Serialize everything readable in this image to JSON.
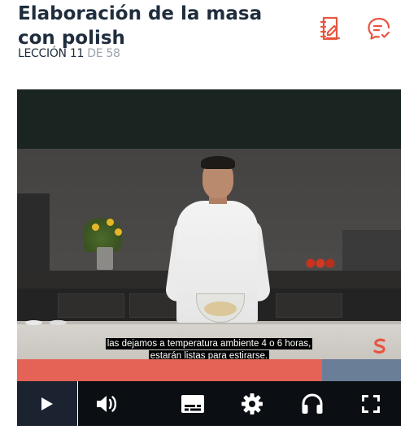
{
  "header": {
    "title": "Elaboración de la masa con polish",
    "lesson_label": "LECCIÓN",
    "lesson_current": "11",
    "lesson_of": "DE",
    "lesson_total": "58",
    "notes_icon": "notebook-edit-icon",
    "comments_icon": "chat-bubble-icon",
    "accent_color": "#e8553f"
  },
  "player": {
    "subtitle_line1": "las dejamos a temperatura ambiente 4 o 6 horas,",
    "subtitle_line2": "estarán listas para estirarse.",
    "progress_fraction": 0.795,
    "progress_color": "#e46356",
    "track_color": "#6a7e98",
    "controls": {
      "play_icon": "play-icon",
      "volume_icon": "volume-icon",
      "captions_icon": "subtitles-icon",
      "settings_icon": "gear-icon",
      "audio_icon": "headphones-icon",
      "fullscreen_icon": "fullscreen-icon"
    }
  }
}
